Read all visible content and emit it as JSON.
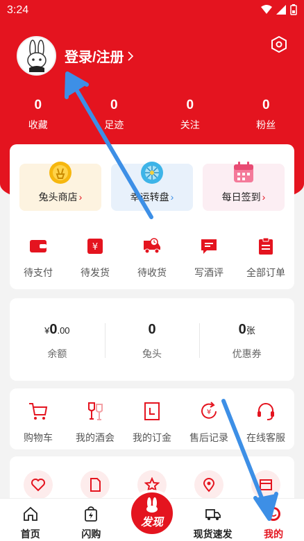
{
  "status": {
    "time": "3:24"
  },
  "profile": {
    "login_text": "登录/注册"
  },
  "stats": [
    {
      "value": "0",
      "label": "收藏"
    },
    {
      "value": "0",
      "label": "足迹"
    },
    {
      "value": "0",
      "label": "关注"
    },
    {
      "value": "0",
      "label": "粉丝"
    }
  ],
  "features": [
    {
      "label": "兔头商店",
      "icon": "coin-icon"
    },
    {
      "label": "幸运转盘",
      "icon": "wheel-icon"
    },
    {
      "label": "每日签到",
      "icon": "calendar-icon"
    }
  ],
  "orders": [
    {
      "label": "待支付",
      "icon": "wallet-icon"
    },
    {
      "label": "待发货",
      "icon": "yuan-box-icon"
    },
    {
      "label": "待收货",
      "icon": "truck-icon"
    },
    {
      "label": "写酒评",
      "icon": "comment-icon"
    },
    {
      "label": "全部订单",
      "icon": "clipboard-icon"
    }
  ],
  "wallet": [
    {
      "prefix": "¥",
      "value": "0",
      "suffix": ".00",
      "label": "余额"
    },
    {
      "prefix": "",
      "value": "0",
      "suffix": "",
      "label": "兔头"
    },
    {
      "prefix": "",
      "value": "0",
      "suffix": "张",
      "label": "优惠券"
    }
  ],
  "tools": [
    {
      "label": "购物车",
      "icon": "cart-icon"
    },
    {
      "label": "我的酒会",
      "icon": "wine-glasses-icon"
    },
    {
      "label": "我的订金",
      "icon": "deposit-icon"
    },
    {
      "label": "售后记录",
      "icon": "refund-icon"
    },
    {
      "label": "在线客服",
      "icon": "headset-icon"
    }
  ],
  "tabs": [
    {
      "label": "首页",
      "icon": "home-icon"
    },
    {
      "label": "闪购",
      "icon": "flash-bag-icon"
    },
    {
      "label": "发现",
      "icon": "rabbit-logo-icon"
    },
    {
      "label": "现货速发",
      "icon": "delivery-truck-icon"
    },
    {
      "label": "我的",
      "icon": "profile-icon"
    }
  ],
  "colors": {
    "brand": "#e4141f",
    "annotation_arrow": "#3d8fe6"
  }
}
